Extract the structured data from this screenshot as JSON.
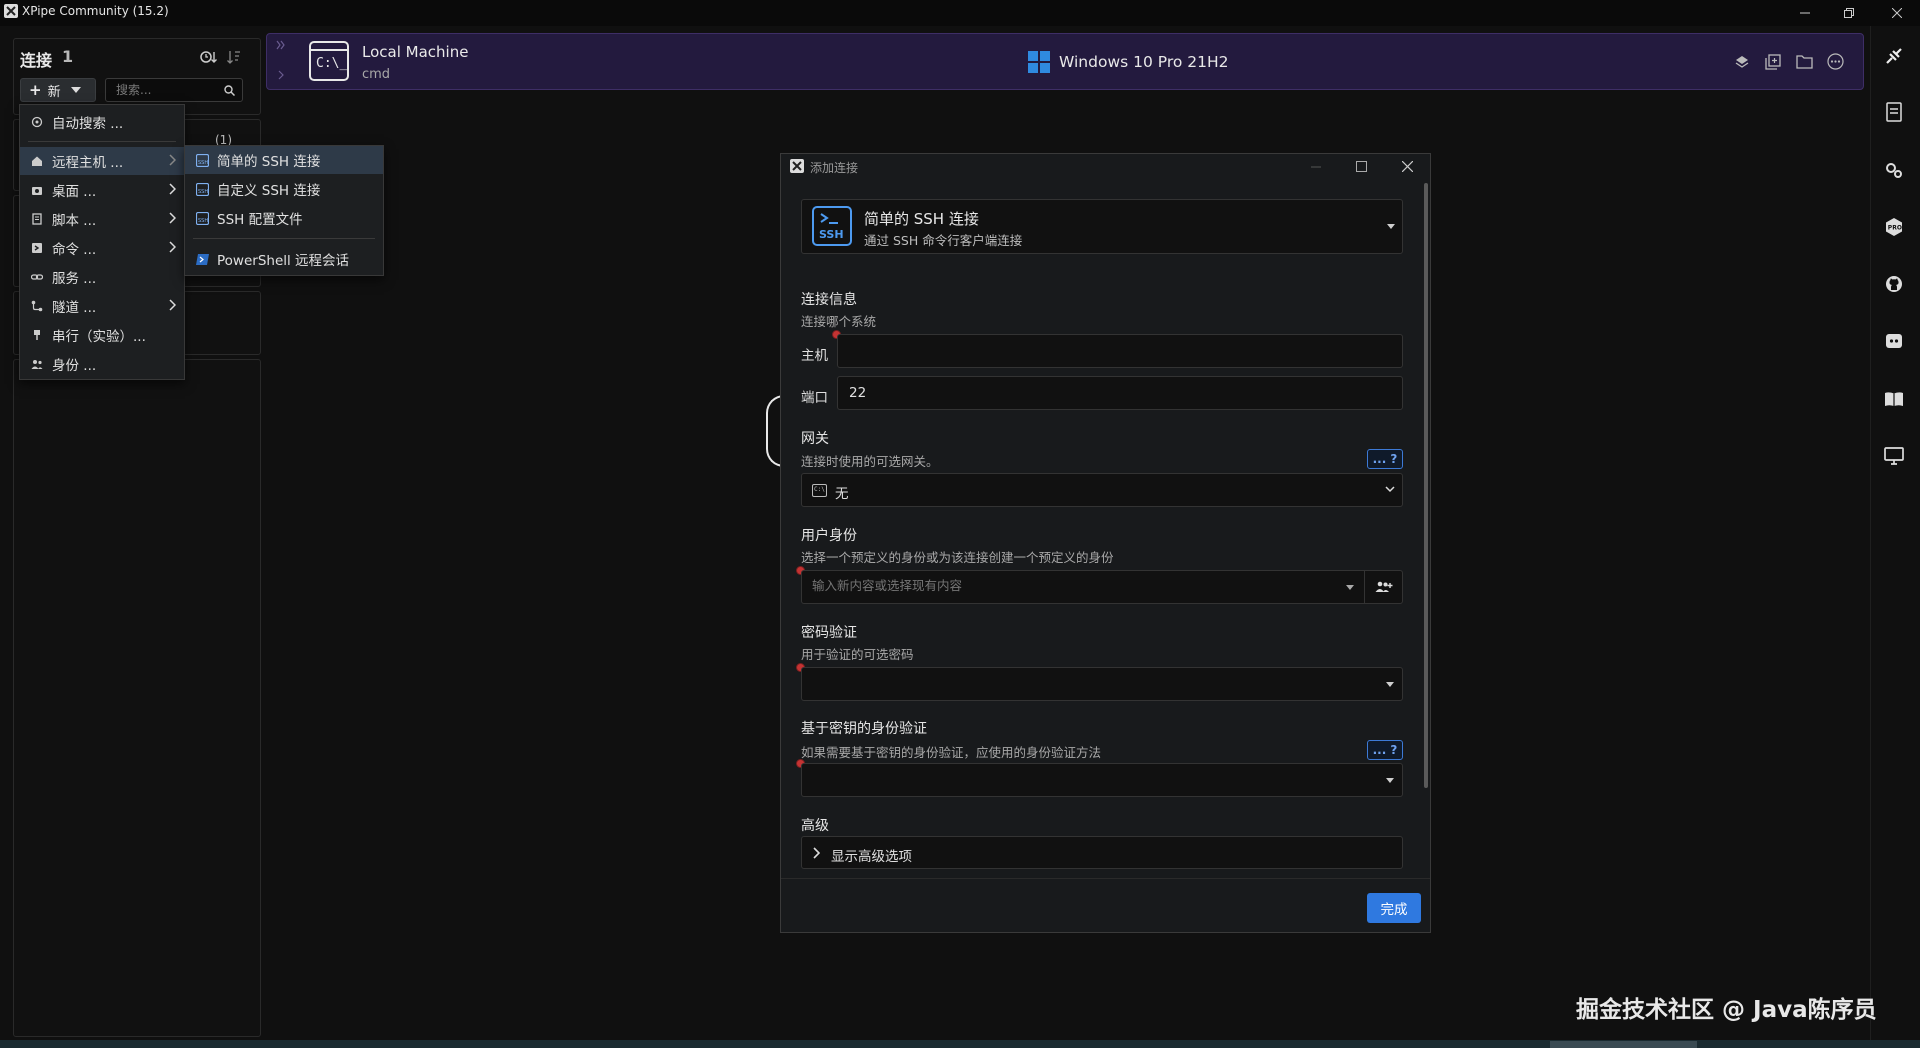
{
  "window": {
    "title": "XPipe Community (15.2)"
  },
  "sidebar": {
    "title": "连接",
    "count": "1",
    "new_label": "新",
    "search_placeholder": "搜索...",
    "group_count": "(1)"
  },
  "new_menu": {
    "items": [
      {
        "label": "自动搜索 ...",
        "icon": "auto-discover-icon",
        "has_submenu": false
      },
      {
        "label": "远程主机 ...",
        "icon": "home-icon",
        "has_submenu": true
      },
      {
        "label": "桌面 ...",
        "icon": "camera-icon",
        "has_submenu": true
      },
      {
        "label": "脚本 ...",
        "icon": "script-icon",
        "has_submenu": true
      },
      {
        "label": "命令 ...",
        "icon": "command-icon",
        "has_submenu": true
      },
      {
        "label": "服务 ...",
        "icon": "link-icon",
        "has_submenu": false
      },
      {
        "label": "隧道 ...",
        "icon": "tunnel-icon",
        "has_submenu": true
      },
      {
        "label": "串行（实验）...",
        "icon": "serial-icon",
        "has_submenu": false
      },
      {
        "label": "身份 ...",
        "icon": "identity-icon",
        "has_submenu": false
      }
    ]
  },
  "remote_submenu": {
    "items": [
      {
        "label": "简单的 SSH 连接",
        "icon": "ssh-icon"
      },
      {
        "label": "自定义 SSH 连接",
        "icon": "ssh-custom-icon"
      },
      {
        "label": "SSH 配置文件",
        "icon": "ssh-config-icon"
      },
      {
        "label": "PowerShell 远程会话",
        "icon": "powershell-icon"
      }
    ]
  },
  "topbar": {
    "machine_name": "Local Machine",
    "shell": "cmd",
    "os": "Windows 10 Pro 21H2"
  },
  "dialog": {
    "window_title": "添加连接",
    "type_title": "简单的 SSH 连接",
    "type_desc": "通过 SSH 命令行客户端连接",
    "conn_info_title": "连接信息",
    "conn_info_desc": "连接哪个系统",
    "host_label": "主机",
    "host_value": "",
    "port_label": "端口",
    "port_value": "22",
    "gateway_title": "网关",
    "gateway_desc": "连接时使用的可选网关。",
    "gateway_value": "无",
    "identity_title": "用户身份",
    "identity_desc": "选择一个预定义的身份或为该连接创建一个预定义的身份",
    "identity_placeholder": "输入新内容或选择现有内容",
    "password_title": "密码验证",
    "password_desc": "用于验证的可选密码",
    "key_title": "基于密钥的身份验证",
    "key_desc": "如果需要基于密钥的身份验证，应使用的身份验证方法",
    "advanced_title": "高级",
    "advanced_toggle": "显示高级选项",
    "help_label": "... ?",
    "done_label": "完成"
  },
  "watermark": "掘金技术社区 @ Java陈序员",
  "colors": {
    "accent": "#2f79e0",
    "topbar_bg": "#231a3e",
    "required": "#c43333"
  }
}
